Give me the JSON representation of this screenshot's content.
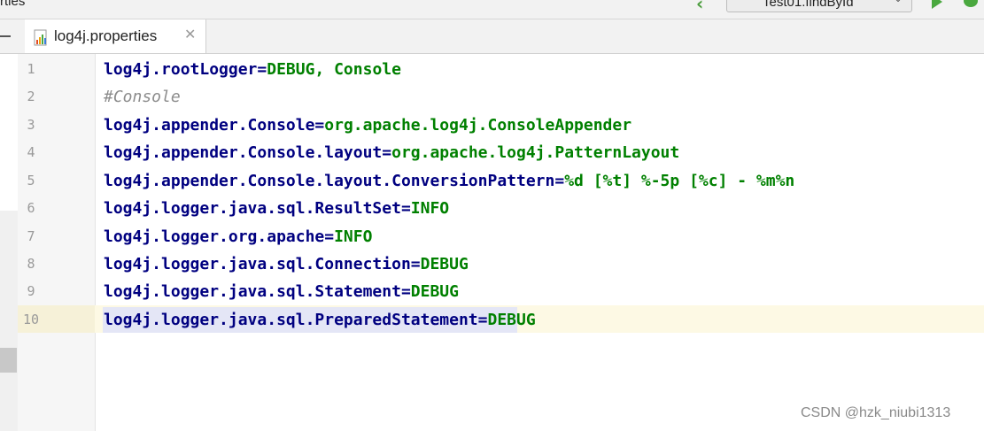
{
  "toolbar": {
    "breadcrumb_fragment": "rties",
    "run_config_label": "Test01.findById"
  },
  "tab": {
    "file_name": "log4j.properties",
    "close_glyph": "✕"
  },
  "editor": {
    "current_line": 10,
    "lines": [
      {
        "num": "1",
        "key": "log4j.rootLogger",
        "value": "DEBUG, Console"
      },
      {
        "num": "2",
        "comment": "#Console"
      },
      {
        "num": "3",
        "key": "log4j.appender.Console",
        "value": "org.apache.log4j.ConsoleAppender"
      },
      {
        "num": "4",
        "key": "log4j.appender.Console.layout",
        "value": "org.apache.log4j.PatternLayout"
      },
      {
        "num": "5",
        "key": "log4j.appender.Console.layout.ConversionPattern",
        "value": "%d [%t] %-5p [%c] - %m%n"
      },
      {
        "num": "6",
        "key": "log4j.logger.java.sql.ResultSet",
        "value": "INFO"
      },
      {
        "num": "7",
        "key": "log4j.logger.org.apache",
        "value": "INFO"
      },
      {
        "num": "8",
        "key": "log4j.logger.java.sql.Connection",
        "value": "DEBUG"
      },
      {
        "num": "9",
        "key": "log4j.logger.java.sql.Statement",
        "value": "DEBUG"
      },
      {
        "num": "10",
        "key": "log4j.logger.java.sql.PreparedStatement",
        "value": "DEBUG"
      }
    ]
  },
  "watermark": "CSDN @hzk_niubi1313",
  "colors": {
    "key": "#000080",
    "value": "#008000",
    "comment": "#8c8c8c",
    "current_line_bg": "#fdf9e4"
  }
}
